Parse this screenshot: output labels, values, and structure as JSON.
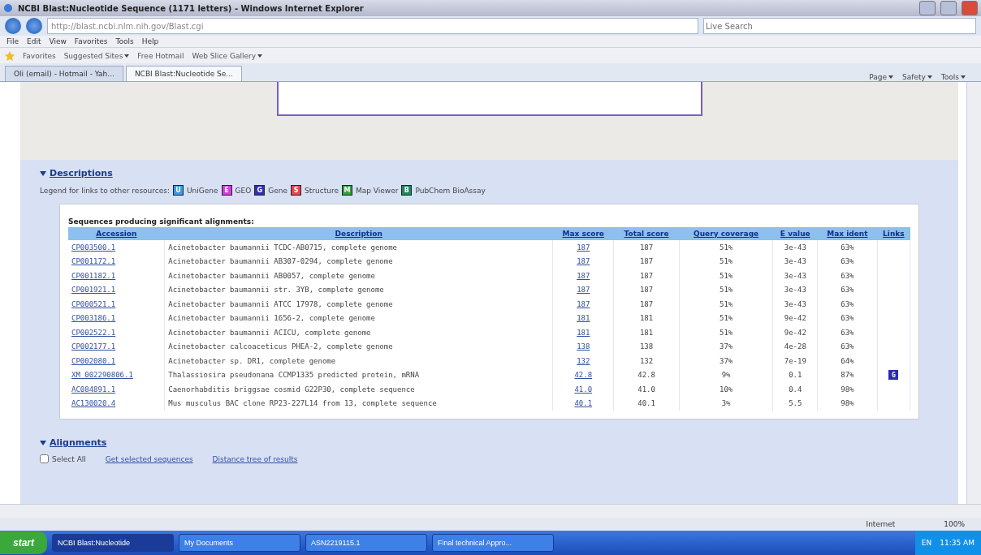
{
  "window": {
    "title": "NCBI Blast:Nucleotide Sequence (1171 letters) - Windows Internet Explorer"
  },
  "address_bar": {
    "url": "http://blast.ncbi.nlm.nih.gov/Blast.cgi",
    "search_placeholder": "Live Search"
  },
  "menu": [
    "File",
    "Edit",
    "View",
    "Favorites",
    "Tools",
    "Help"
  ],
  "favorites_bar": {
    "label": "Favorites",
    "links": [
      {
        "label": "Suggested Sites",
        "dropdown": true
      },
      {
        "label": "Free Hotmail",
        "dropdown": false
      },
      {
        "label": "Web Slice Gallery",
        "dropdown": true
      }
    ]
  },
  "tabs": [
    {
      "label": "Oli (email) - Hotmail - Yah...",
      "selected": false
    },
    {
      "label": "NCBI Blast:Nucleotide Se...",
      "selected": true
    }
  ],
  "command_bar": [
    "Page",
    "Safety",
    "Tools"
  ],
  "descriptions": {
    "heading": "Descriptions",
    "expanded": true,
    "legend_label": "Legend for links to other resources:",
    "legend": [
      {
        "letter": "U",
        "label": "UniGene",
        "color": "#3a9ae8"
      },
      {
        "letter": "E",
        "label": "GEO",
        "color": "#d040d8"
      },
      {
        "letter": "G",
        "label": "Gene",
        "color": "#3030b0"
      },
      {
        "letter": "S",
        "label": "Structure",
        "color": "#e04848"
      },
      {
        "letter": "M",
        "label": "Map Viewer",
        "color": "#30a030"
      },
      {
        "letter": "B",
        "label": "PubChem BioAssay",
        "color": "#20885a"
      }
    ],
    "table_title": "Sequences producing significant alignments:",
    "columns": [
      "Accession",
      "Description",
      "Max score",
      "Total score",
      "Query coverage",
      "E value",
      "Max ident",
      "Links"
    ],
    "rows": [
      {
        "accession": "CP003500.1",
        "description": "Acinetobacter baumannii TCDC-AB0715, complete genome",
        "max_score": "187",
        "total_score": "187",
        "coverage": "51%",
        "evalue": "3e-43",
        "ident": "63%"
      },
      {
        "accession": "CP001172.1",
        "description": "Acinetobacter baumannii AB307-0294, complete genome",
        "max_score": "187",
        "total_score": "187",
        "coverage": "51%",
        "evalue": "3e-43",
        "ident": "63%"
      },
      {
        "accession": "CP001182.1",
        "description": "Acinetobacter baumannii AB0057, complete genome",
        "max_score": "187",
        "total_score": "187",
        "coverage": "51%",
        "evalue": "3e-43",
        "ident": "63%"
      },
      {
        "accession": "CP001921.1",
        "description": "Acinetobacter baumannii str. 3YB, complete genome",
        "max_score": "187",
        "total_score": "187",
        "coverage": "51%",
        "evalue": "3e-43",
        "ident": "63%"
      },
      {
        "accession": "CP000521.1",
        "description": "Acinetobacter baumannii ATCC 17978, complete genome",
        "max_score": "187",
        "total_score": "187",
        "coverage": "51%",
        "evalue": "3e-43",
        "ident": "63%"
      },
      {
        "accession": "CP003186.1",
        "description": "Acinetobacter baumannii 1656-2, complete genome",
        "max_score": "181",
        "total_score": "181",
        "coverage": "51%",
        "evalue": "9e-42",
        "ident": "63%"
      },
      {
        "accession": "CP002522.1",
        "description": "Acinetobacter baumannii ACICU, complete genome",
        "max_score": "181",
        "total_score": "181",
        "coverage": "51%",
        "evalue": "9e-42",
        "ident": "63%"
      },
      {
        "accession": "CP002177.1",
        "description": "Acinetobacter calcoaceticus PHEA-2, complete genome",
        "max_score": "138",
        "total_score": "138",
        "coverage": "37%",
        "evalue": "4e-28",
        "ident": "63%"
      },
      {
        "accession": "CP002080.1",
        "description": "Acinetobacter sp. DR1, complete genome",
        "max_score": "132",
        "total_score": "132",
        "coverage": "37%",
        "evalue": "7e-19",
        "ident": "64%"
      },
      {
        "accession": "XM_002290806.1",
        "description": "Thalassiosira pseudonana CCMP1335 predicted protein, mRNA",
        "max_score": "42.8",
        "total_score": "42.8",
        "coverage": "9%",
        "evalue": "0.1",
        "ident": "87%",
        "link_icon": "G"
      },
      {
        "accession": "AC084891.1",
        "description": "Caenorhabditis briggsae cosmid G22P30, complete sequence",
        "max_score": "41.0",
        "total_score": "41.0",
        "coverage": "10%",
        "evalue": "0.4",
        "ident": "98%"
      },
      {
        "accession": "AC130020.4",
        "description": "Mus musculus BAC clone RP23-227L14 from 13, complete sequence",
        "max_score": "40.1",
        "total_score": "40.1",
        "coverage": "3%",
        "evalue": "5.5",
        "ident": "98%"
      }
    ]
  },
  "alignments": {
    "heading": "Alignments",
    "expanded": true,
    "select_all": {
      "label": "Select All",
      "checked": false
    },
    "links": [
      "Get selected sequences",
      "Distance tree of results"
    ]
  },
  "status_bar": {
    "zone": "Internet",
    "zoom": "100%"
  },
  "taskbar": {
    "start": "start",
    "tasks": [
      {
        "label": "NCBI Blast:Nucleotide",
        "selected": true
      },
      {
        "label": "My Documents",
        "selected": false
      },
      {
        "label": "ASN2219115.1",
        "selected": false
      },
      {
        "label": "Final technical Appro...",
        "selected": false
      }
    ],
    "language": "EN",
    "clock": "11:35 AM"
  }
}
